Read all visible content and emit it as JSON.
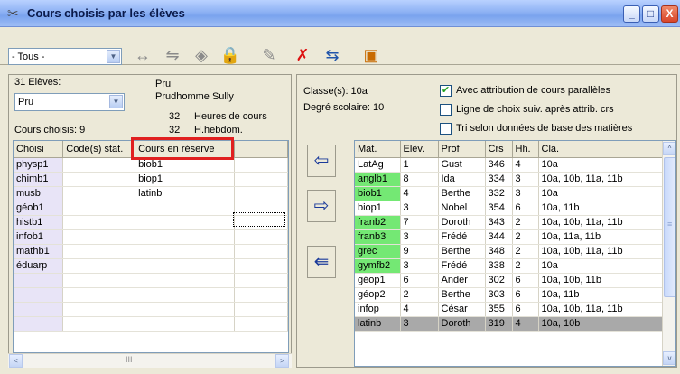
{
  "window": {
    "title": "Cours choisis par les élèves",
    "minimize": "_",
    "maximize": "□",
    "close": "X"
  },
  "toolbar": {
    "combo_value": "- Tous -"
  },
  "left": {
    "eleves_count": "31 Elèves:",
    "student_code": "Pru",
    "student_select": "Pru",
    "student_name": "Prudhomme Sully",
    "cours_heures_num": "32",
    "cours_heures_label": "Heures de cours",
    "hebdo_num": "32",
    "hebdo_label": "H.hebdom.",
    "cours_choisis": "Cours choisis: 9",
    "grid_headers": [
      "Choisi",
      "Code(s) stat.",
      "Cours en réserve",
      ""
    ],
    "grid_rows": [
      [
        "physp1",
        "",
        "biob1",
        ""
      ],
      [
        "chimb1",
        "",
        "biop1",
        ""
      ],
      [
        "musb",
        "",
        "latinb",
        ""
      ],
      [
        "géob1",
        "",
        "",
        ""
      ],
      [
        "histb1",
        "",
        "",
        ""
      ],
      [
        "infob1",
        "",
        "",
        ""
      ],
      [
        "mathb1",
        "",
        "",
        ""
      ],
      [
        "éduarp",
        "",
        "",
        ""
      ]
    ],
    "scroll_left": "<",
    "scroll_right": ">",
    "scroll_grip": "III"
  },
  "right": {
    "classes": "Classe(s): 10a",
    "degree": "Degré scolaire: 10",
    "check1": "Avec attribution de cours parallèles",
    "check2": "Ligne de choix suiv. après attrib. crs",
    "check3": "Tri selon données de base des matières",
    "grid_headers": [
      "Mat.",
      "Elèv.",
      "Prof",
      "Crs",
      "Hh.",
      "Cla."
    ],
    "grid_rows": [
      [
        "LatAg",
        "1",
        "Gust",
        "346",
        "4",
        "10a"
      ],
      [
        "anglb1",
        "8",
        "Ida",
        "334",
        "3",
        "10a, 10b, 11a, 11b"
      ],
      [
        "biob1",
        "4",
        "Berthe",
        "332",
        "3",
        "10a"
      ],
      [
        "biop1",
        "3",
        "Nobel",
        "354",
        "6",
        "10a, 11b"
      ],
      [
        "franb2",
        "7",
        "Doroth",
        "343",
        "2",
        "10a, 10b, 11a, 11b"
      ],
      [
        "franb3",
        "3",
        "Frédé",
        "344",
        "2",
        "10a, 11a, 11b"
      ],
      [
        "grec",
        "9",
        "Berthe",
        "348",
        "2",
        "10a, 10b, 11a, 11b"
      ],
      [
        "gymfb2",
        "3",
        "Frédé",
        "338",
        "2",
        "10a"
      ],
      [
        "géop1",
        "6",
        "Ander",
        "302",
        "6",
        "10a, 10b, 11b"
      ],
      [
        "géop2",
        "2",
        "Berthe",
        "303",
        "6",
        "10a, 11b"
      ],
      [
        "infop",
        "4",
        "César",
        "355",
        "6",
        "10a, 10b, 11a, 11b"
      ],
      [
        "latinb",
        "3",
        "Doroth",
        "319",
        "4",
        "10a, 10b"
      ]
    ],
    "green_rows": [
      1,
      2,
      4,
      5,
      6,
      7
    ],
    "selected_row": 11,
    "scroll_up": "^",
    "scroll_down": "v",
    "scroll_grip": "≡"
  },
  "colors": {
    "highlight": "#e02020",
    "green": "#74e874",
    "selected": "#a9a9a9"
  }
}
